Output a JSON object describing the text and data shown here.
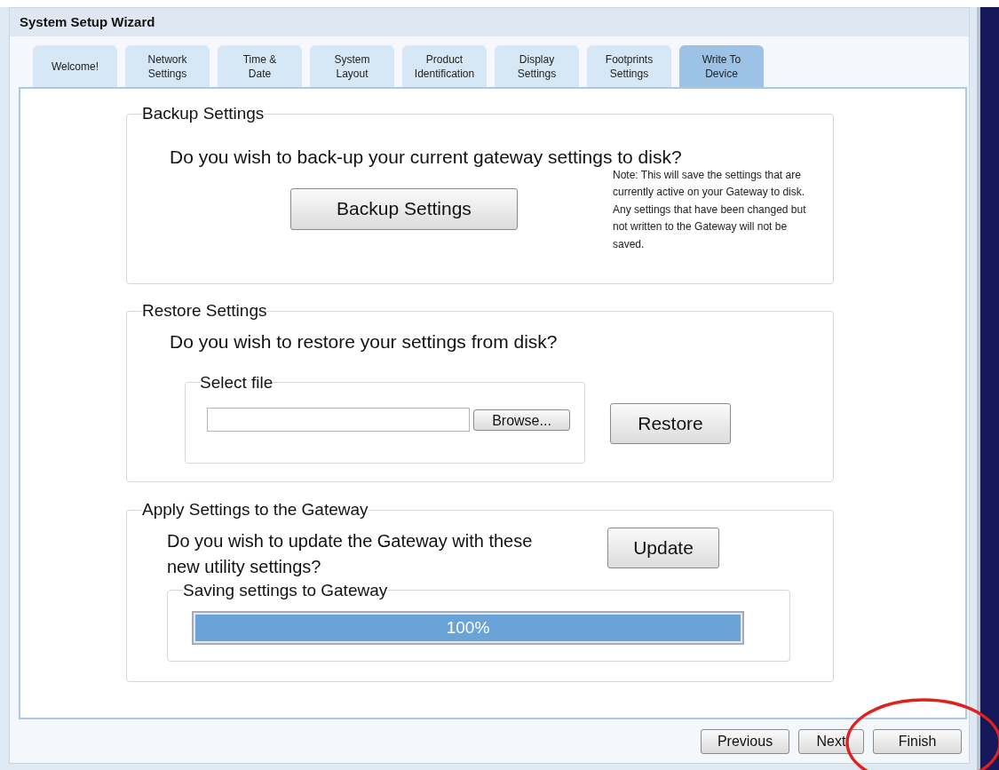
{
  "window": {
    "title": "System Setup Wizard"
  },
  "tabs": [
    {
      "label": "Welcome!",
      "selected": false
    },
    {
      "label": "Network\nSettings",
      "selected": false
    },
    {
      "label": "Time &\nDate",
      "selected": false
    },
    {
      "label": "System\nLayout",
      "selected": false
    },
    {
      "label": "Product\nIdentification",
      "selected": false
    },
    {
      "label": "Display\nSettings",
      "selected": false
    },
    {
      "label": "Footprints\nSettings",
      "selected": false
    },
    {
      "label": "Write To\nDevice",
      "selected": true
    }
  ],
  "backup": {
    "legend": "Backup Settings",
    "question": "Do you wish to back-up your current gateway settings to disk?",
    "button": "Backup Settings",
    "note": "Note: This will save the settings that are currently active on your Gateway to disk. Any settings that have been changed but not written to the Gateway will not be saved."
  },
  "restore": {
    "legend": "Restore Settings",
    "question": "Do you wish to restore your settings from disk?",
    "file_group": {
      "legend": "Select file",
      "browse_button": "Browse..."
    },
    "button": "Restore"
  },
  "apply": {
    "legend": "Apply Settings to the Gateway",
    "question": "Do you wish to update the Gateway with these new utility settings?",
    "button": "Update",
    "progress": {
      "legend": "Saving settings to Gateway",
      "level": 1,
      "reading": "100%"
    }
  },
  "buttons": [
    "Previous",
    "Next",
    "Finish"
  ]
}
